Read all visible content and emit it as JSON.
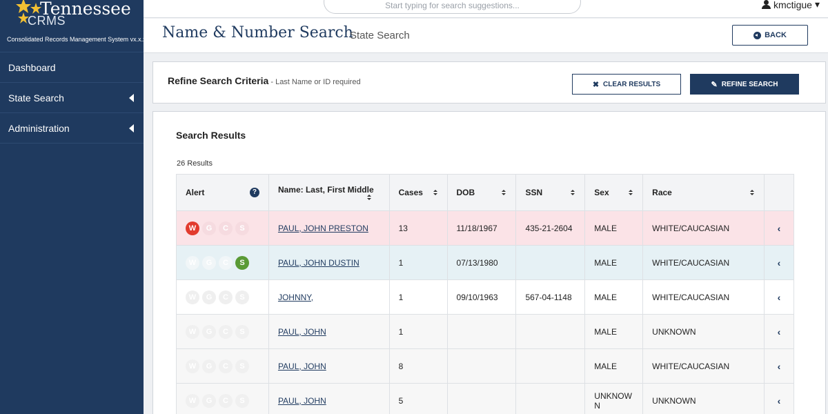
{
  "brand": {
    "title": "Tennessee",
    "subtitle": "CRMS",
    "description": "Consolidated Records Management System vx.x.x"
  },
  "sidebar": {
    "items": [
      {
        "label": "Dashboard"
      },
      {
        "label": "State Search"
      },
      {
        "label": "Administration"
      }
    ]
  },
  "topbar": {
    "search_placeholder": "Start typing for search suggestions...",
    "username": "kmctigue",
    "user_caret": "▾"
  },
  "header": {
    "title": "Name & Number Search",
    "subtitle": "State Search",
    "back_label": "BACK"
  },
  "refine": {
    "title": "Refine Search Criteria",
    "note": " - Last Name or ID required",
    "clear_label": "CLEAR RESULTS",
    "refine_label": "REFINE SEARCH"
  },
  "results": {
    "title": "Search Results",
    "count": "26 Results",
    "columns": [
      "Alert",
      "Name: Last, First Middle",
      "Cases",
      "DOB",
      "SSN",
      "Sex",
      "Race"
    ],
    "alert_letters": [
      "W",
      "G",
      "C",
      "S"
    ],
    "alert_colors": {
      "W": "#e23b2e",
      "S": "#5a9a35"
    },
    "rows": [
      {
        "style": "pink",
        "alerts": [
          "W"
        ],
        "name": "PAUL, JOHN PRESTON",
        "cases": "13",
        "dob": "11/18/1967",
        "ssn": "435-21-2604",
        "sex": "MALE",
        "race": "WHITE/CAUCASIAN"
      },
      {
        "style": "blue",
        "alerts": [
          "S"
        ],
        "name": "PAUL, JOHN DUSTIN",
        "cases": "1",
        "dob": "07/13/1980",
        "ssn": "",
        "sex": "MALE",
        "race": "WHITE/CAUCASIAN"
      },
      {
        "style": "white",
        "alerts": [],
        "name": "JOHNNY,",
        "cases": "1",
        "dob": "09/10/1963",
        "ssn": "567-04-1148",
        "sex": "MALE",
        "race": "WHITE/CAUCASIAN"
      },
      {
        "style": "gray",
        "alerts": [],
        "name": "PAUL, JOHN",
        "cases": "1",
        "dob": "",
        "ssn": "",
        "sex": "MALE",
        "race": "UNKNOWN"
      },
      {
        "style": "gray",
        "alerts": [],
        "name": "PAUL, JOHN",
        "cases": "8",
        "dob": "",
        "ssn": "",
        "sex": "MALE",
        "race": "WHITE/CAUCASIAN"
      },
      {
        "style": "gray",
        "alerts": [],
        "name": "PAUL, JOHN",
        "cases": "5",
        "dob": "",
        "ssn": "",
        "sex": "UNKNOW N",
        "race": "UNKNOWN"
      }
    ],
    "row_chevron": "‹"
  }
}
